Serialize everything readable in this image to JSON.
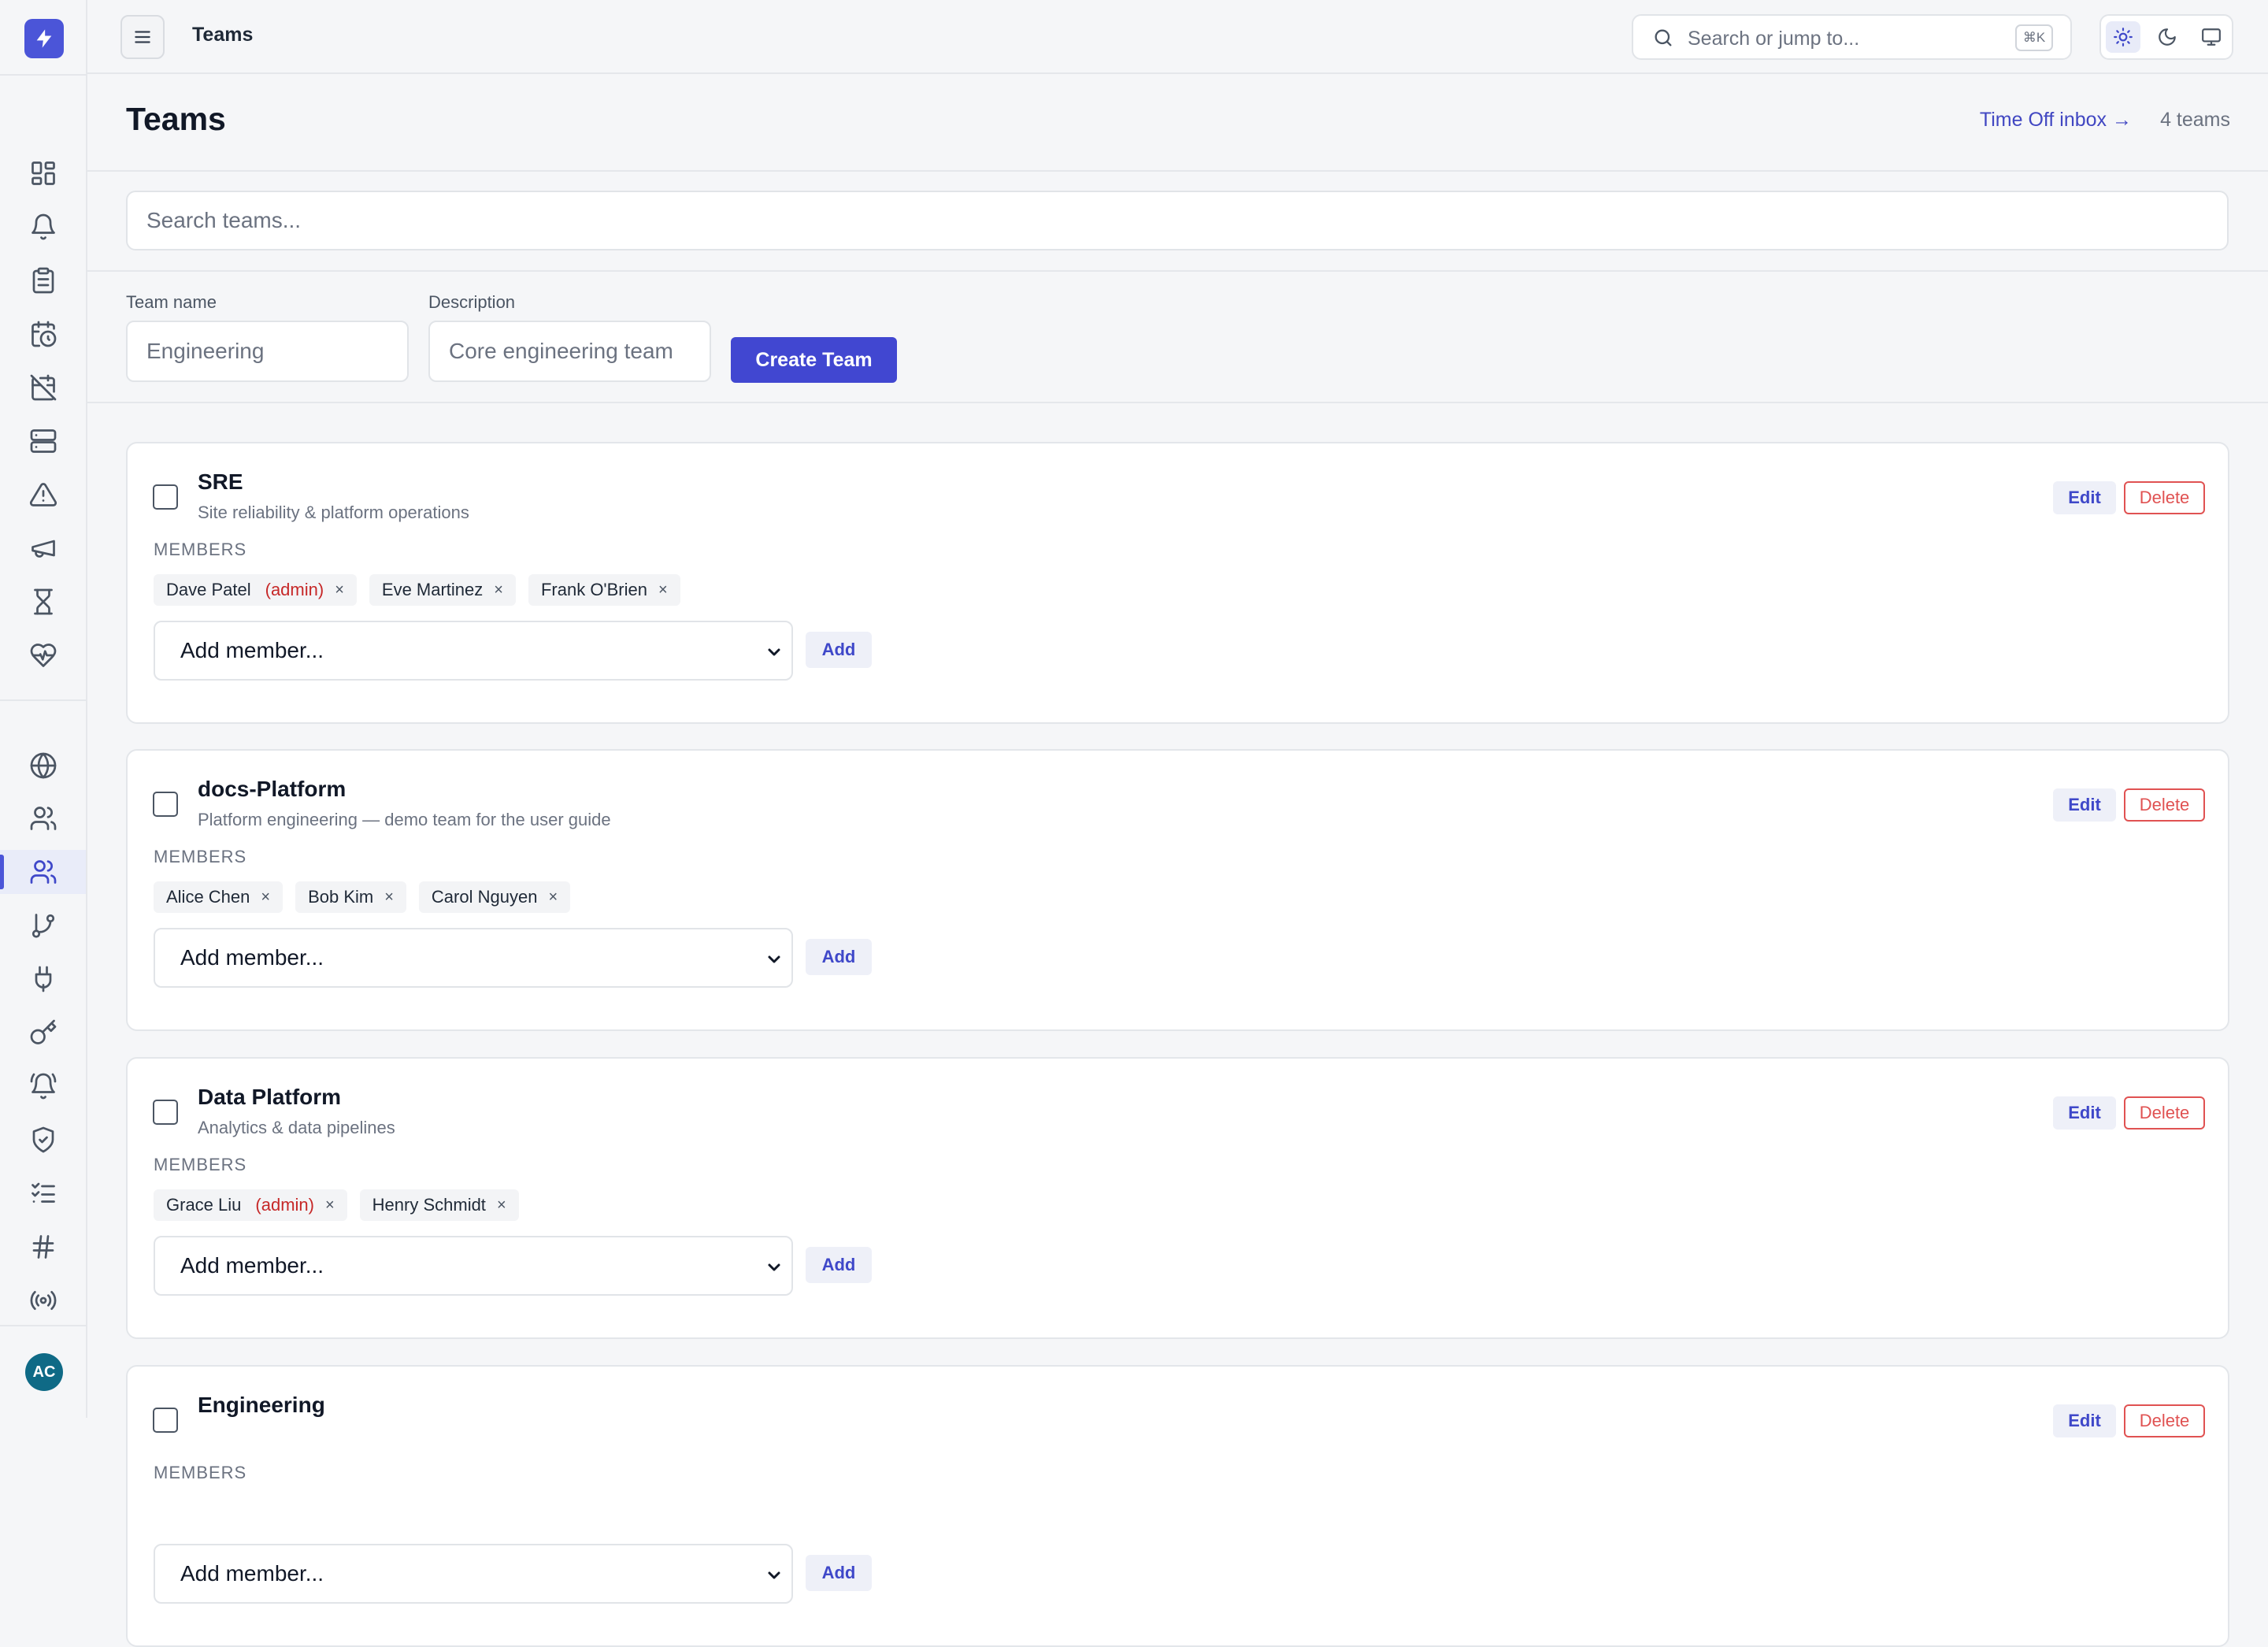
{
  "topbar": {
    "title": "Teams",
    "search_placeholder": "Search or jump to...",
    "shortcut": "⌘K"
  },
  "page": {
    "title": "Teams",
    "inbox_link": "Time Off inbox →",
    "team_count": "4 teams"
  },
  "search": {
    "placeholder": "Search teams..."
  },
  "create_form": {
    "name_label": "Team name",
    "name_placeholder": "Engineering",
    "desc_label": "Description",
    "desc_placeholder": "Core engineering team",
    "submit_label": "Create Team"
  },
  "user": {
    "initials": "AC"
  },
  "labels": {
    "members": "MEMBERS",
    "add_member_placeholder": "Add member...",
    "add": "Add",
    "edit": "Edit",
    "delete": "Delete",
    "admin": "(admin)",
    "remove": "×"
  },
  "teams": [
    {
      "name": "SRE",
      "description": "Site reliability & platform operations",
      "members": [
        {
          "name": "Dave Patel",
          "admin": true
        },
        {
          "name": "Eve Martinez",
          "admin": false
        },
        {
          "name": "Frank O'Brien",
          "admin": false
        }
      ]
    },
    {
      "name": "docs-Platform",
      "description": "Platform engineering — demo team for the user guide",
      "members": [
        {
          "name": "Alice Chen",
          "admin": false
        },
        {
          "name": "Bob Kim",
          "admin": false
        },
        {
          "name": "Carol Nguyen",
          "admin": false
        }
      ]
    },
    {
      "name": "Data Platform",
      "description": "Analytics & data pipelines",
      "members": [
        {
          "name": "Grace Liu",
          "admin": true
        },
        {
          "name": "Henry Schmidt",
          "admin": false
        }
      ]
    },
    {
      "name": "Engineering",
      "description": "",
      "members": []
    }
  ],
  "nav_icons": [
    "dashboard-icon",
    "bell-icon",
    "clipboard-icon",
    "calendar-clock-icon",
    "calendar-off-icon",
    "server-icon",
    "alert-triangle-icon",
    "megaphone-icon",
    "hourglass-icon",
    "heart-pulse-icon",
    "globe-icon",
    "users-icon",
    "teams-icon",
    "git-branch-icon",
    "plug-icon",
    "key-icon",
    "bell-ring-icon",
    "shield-check-icon",
    "checklist-icon",
    "hash-icon",
    "broadcast-icon"
  ],
  "theme": {
    "accent": "#4147d1",
    "danger": "#e05252",
    "admin_color": "#c62828"
  }
}
